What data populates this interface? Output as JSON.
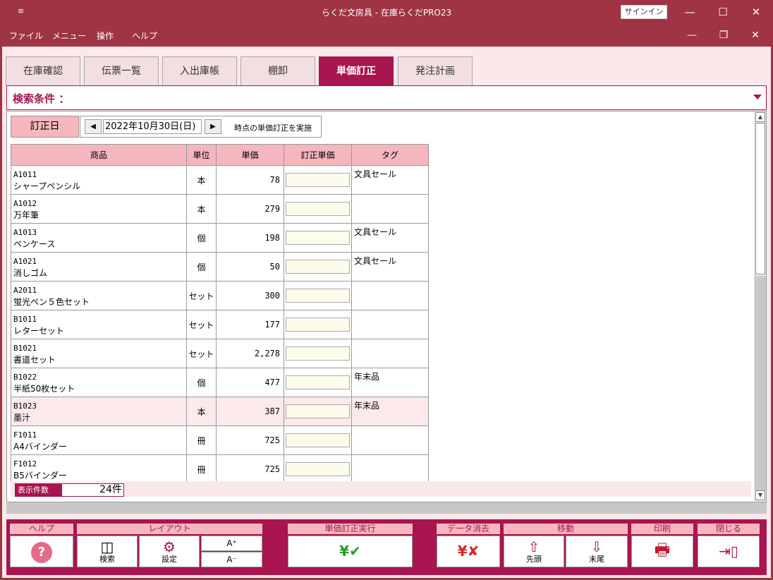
{
  "window": {
    "title": "らくだ文房具  -  在庫らくだPRO23",
    "signin_label": "サインイン",
    "quick_access_glyph": "≡",
    "minimize_glyph": "—",
    "maximize_glyph": "☐",
    "close_glyph": "✕"
  },
  "menu": {
    "items": [
      "ファイル",
      "メニュー",
      "操作",
      "ヘルプ"
    ],
    "mdi_minimize_glyph": "—",
    "mdi_restore_glyph": "❐",
    "mdi_close_glyph": "✕"
  },
  "tabs": [
    {
      "label": "在庫確認",
      "active": false
    },
    {
      "label": "伝票一覧",
      "active": false
    },
    {
      "label": "入出庫帳",
      "active": false
    },
    {
      "label": "棚卸",
      "active": false
    },
    {
      "label": "単価訂正",
      "active": true
    },
    {
      "label": "発注計画",
      "active": false
    }
  ],
  "search": {
    "label": "検索条件 ："
  },
  "date": {
    "label": "訂正日",
    "value": "2022年10月30日(日)",
    "suffix": "時点の単価訂正を実施",
    "prev_glyph": "◀",
    "next_glyph": "▶"
  },
  "table": {
    "headers": [
      "商品",
      "単位",
      "単価",
      "訂正単価",
      "タグ"
    ],
    "rows": [
      {
        "code": "A1011",
        "name": "シャープペンシル",
        "unit": "本",
        "price": "78",
        "edit": "",
        "tag": "文具セール"
      },
      {
        "code": "A1012",
        "name": "万年筆",
        "unit": "本",
        "price": "279",
        "edit": "",
        "tag": ""
      },
      {
        "code": "A1013",
        "name": "ペンケース",
        "unit": "個",
        "price": "198",
        "edit": "",
        "tag": "文具セール"
      },
      {
        "code": "A1021",
        "name": "消しゴム",
        "unit": "個",
        "price": "50",
        "edit": "",
        "tag": "文具セール"
      },
      {
        "code": "A2011",
        "name": "蛍光ペン５色セット",
        "unit": "セット",
        "price": "300",
        "edit": "",
        "tag": ""
      },
      {
        "code": "B1011",
        "name": "レターセット",
        "unit": "セット",
        "price": "177",
        "edit": "",
        "tag": ""
      },
      {
        "code": "B1021",
        "name": "書道セット",
        "unit": "セット",
        "price": "2,278",
        "edit": "",
        "tag": ""
      },
      {
        "code": "B1022",
        "name": "半紙50枚セット",
        "unit": "個",
        "price": "477",
        "edit": "",
        "tag": "年末品"
      },
      {
        "code": "B1023",
        "name": "墨汁",
        "unit": "本",
        "price": "387",
        "edit": "",
        "tag": "年末品",
        "selected": true
      },
      {
        "code": "F1011",
        "name": "A4バインダー",
        "unit": "冊",
        "price": "725",
        "edit": "",
        "tag": ""
      },
      {
        "code": "F1012",
        "name": "B5バインダー",
        "unit": "冊",
        "price": "725",
        "edit": "",
        "tag": ""
      }
    ]
  },
  "count": {
    "label": "表示件数",
    "value": "24件"
  },
  "scroll": {
    "up_glyph": "▲",
    "down_glyph": "▼"
  },
  "toolbar": {
    "help": {
      "head": "ヘルプ",
      "icon": "?"
    },
    "layout": {
      "head": "レイアウト",
      "search": "検索",
      "settings": "設定",
      "font_up": "A⁺",
      "font_down": "A⁻",
      "search_icon_glyph": "◫",
      "settings_icon_glyph": "⚙"
    },
    "execute": {
      "head": "単価訂正実行",
      "icon": "¥✔"
    },
    "clear": {
      "head": "データ消去",
      "icon": "¥✘"
    },
    "move": {
      "head": "移動",
      "first": "先頭",
      "last": "末尾",
      "first_icon_glyph": "⇧",
      "last_icon_glyph": "⇩"
    },
    "print": {
      "head": "印刷",
      "icon": "🖶"
    },
    "close": {
      "head": "閉じる",
      "icon": "⇥▯"
    }
  }
}
